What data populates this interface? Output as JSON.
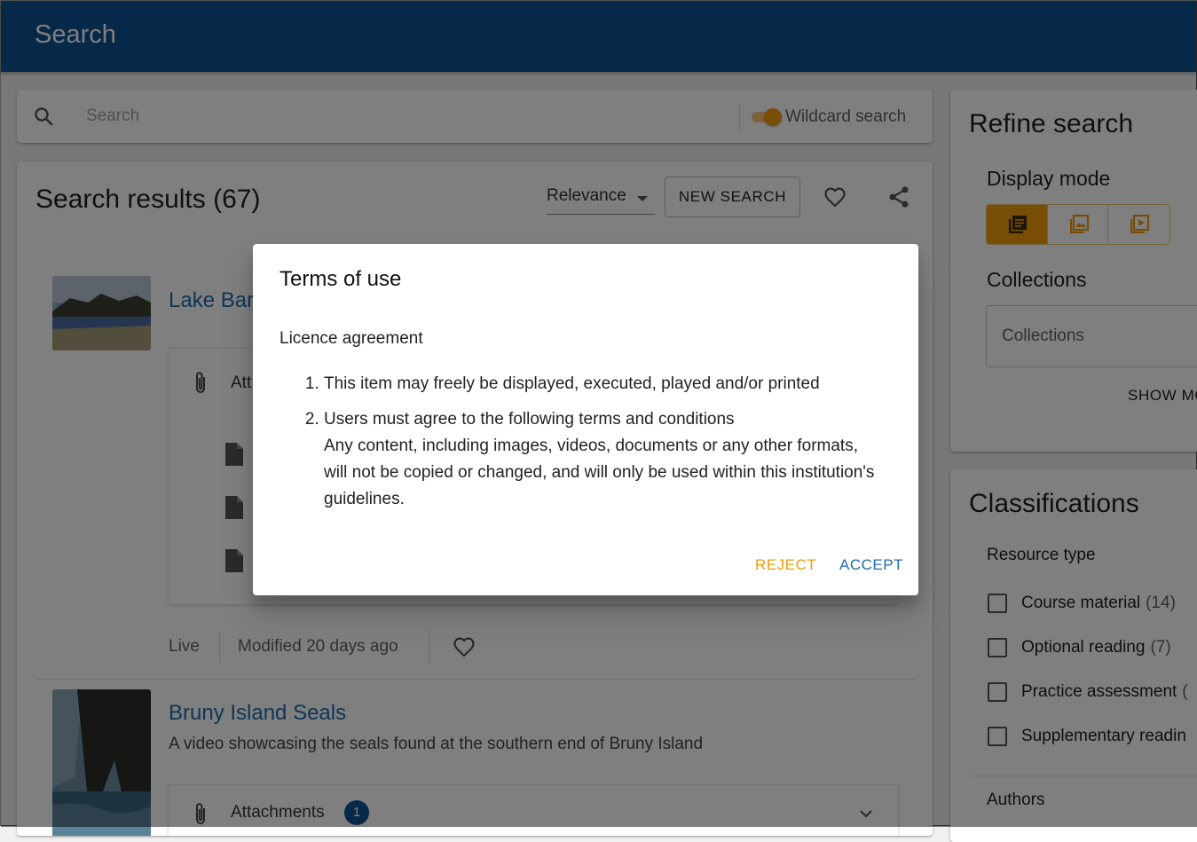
{
  "appbar": {
    "title": "Search"
  },
  "searchbar": {
    "placeholder": "Search",
    "wildcard_label": "Wildcard search",
    "wildcard_on": true
  },
  "results": {
    "heading": "Search results (67)",
    "sort_label": "Relevance",
    "new_search_label": "NEW SEARCH",
    "items": [
      {
        "title": "Lake Bar",
        "attachments_label": "Att",
        "status": "Live",
        "modified": "Modified 20 days ago"
      },
      {
        "title": "Bruny Island Seals",
        "description": "A video showcasing the seals found at the southern end of Bruny Island",
        "attachments_label": "Attachments",
        "attachments_count": "1"
      }
    ]
  },
  "refine": {
    "heading": "Refine search",
    "display_mode_label": "Display mode",
    "display_modes": [
      "list-icon",
      "image-gallery-icon",
      "video-gallery-icon"
    ],
    "collections_label": "Collections",
    "collections_placeholder": "Collections",
    "show_more_label": "SHOW MO"
  },
  "classifications": {
    "heading": "Classifications",
    "resource_type_label": "Resource type",
    "options": [
      {
        "label": "Course material",
        "count": "(14)"
      },
      {
        "label": "Optional reading",
        "count": "(7)"
      },
      {
        "label": "Practice assessment",
        "count": "("
      },
      {
        "label": "Supplementary readin",
        "count": ""
      }
    ],
    "authors_label": "Authors"
  },
  "dialog": {
    "title": "Terms of use",
    "subtitle": "Licence agreement",
    "terms": [
      "This item may freely be displayed, executed, played and/or printed",
      "Users must agree to the following terms and conditions"
    ],
    "terms_detail": "Any content, including images, videos, documents or any other formats, will not be copied or changed, and will only be used within this institution's guidelines.",
    "reject_label": "REJECT",
    "accept_label": "ACCEPT"
  },
  "colors": {
    "primary": "#0d5192",
    "accent": "#f19a0c",
    "link": "#1f6bb0"
  }
}
